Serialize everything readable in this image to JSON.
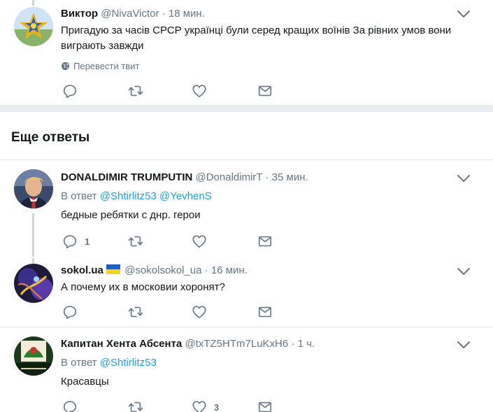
{
  "tweets": [
    {
      "name": "Виктор",
      "handle": "@NivaVictor",
      "dot": "·",
      "time": "18 мин.",
      "text": "Пригадую за часів СРСР українці були серед кращих воїнів За рівних умов вони виграють завжди",
      "translate": "Перевести твит",
      "reply_count": "",
      "retweet_count": "",
      "like_count": ""
    }
  ],
  "section": {
    "title": "Еще ответы"
  },
  "replies": [
    {
      "name": "DONALDIMIR TRUMPUTIN",
      "handle": "@DonaldimirT",
      "dot": "·",
      "time": "35 мин.",
      "reply_prefix": "В ответ",
      "mentions": [
        "@Shtirlitz53",
        "@YevhenS"
      ],
      "text": "бедные ребятки с днр. герои",
      "reply_count": "1",
      "like_count": ""
    },
    {
      "name": "sokol.ua",
      "handle": "@sokolsokol_ua",
      "dot": "·",
      "time": "16 мин.",
      "text": "А почему их в московии хоронят?",
      "reply_count": "",
      "like_count": ""
    },
    {
      "name": "Капитан Хента Абсента",
      "handle": "@txTZ5HTm7LuKxH6",
      "dot": "·",
      "time": "1 ч.",
      "reply_prefix": "В ответ",
      "mentions": [
        "@Shtirlitz53"
      ],
      "text": "Красавцы",
      "reply_count": "",
      "like_count": "3"
    }
  ],
  "colors": {
    "accent": "#1da1f2",
    "muted": "#657786",
    "divider": "#e6ecf0",
    "text": "#14171a",
    "flag_blue": "#1f5fbf",
    "flag_yellow": "#f7d21e"
  },
  "icons": {
    "reply": "reply-icon",
    "retweet": "retweet-icon",
    "like": "heart-icon",
    "dm": "envelope-icon",
    "more": "chevron-down-icon",
    "translate": "globe-icon"
  }
}
